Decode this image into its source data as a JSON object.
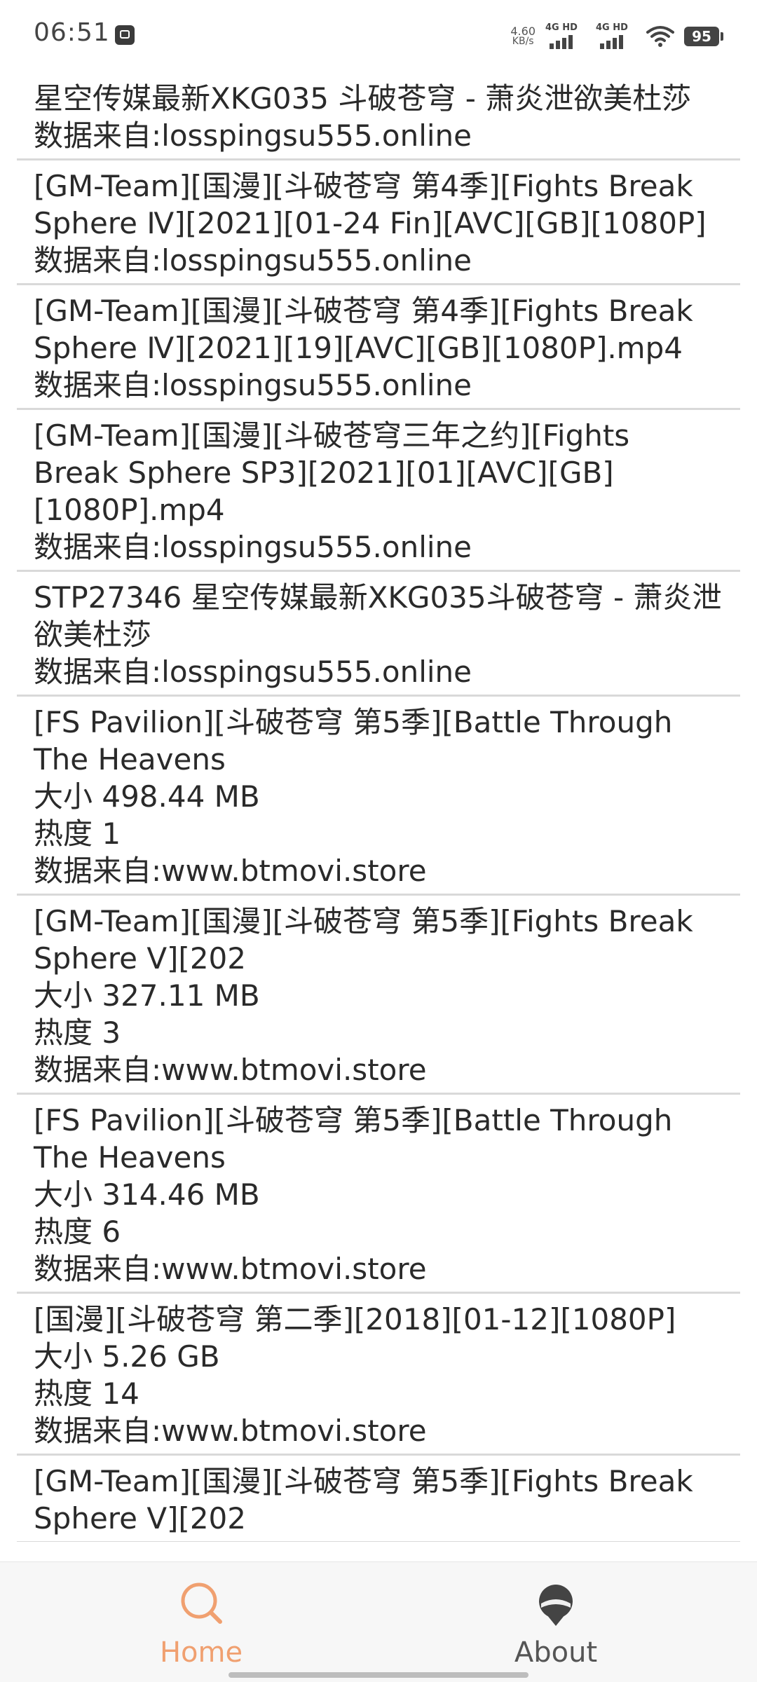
{
  "status_bar": {
    "time": "06:51",
    "net_speed_value": "4.60",
    "net_speed_unit": "KB/s",
    "sim1_label": "4G HD",
    "sim2_label": "4G HD",
    "battery": "95",
    "icons": [
      "app-notification-icon",
      "signal-icon",
      "wifi-icon",
      "battery-icon"
    ]
  },
  "results": [
    {
      "title": "星空传媒最新XKG035 斗破苍穹 - 萧炎泄欲美杜莎",
      "size": "",
      "heat": "",
      "source": " 数据来自:losspingsu555.online"
    },
    {
      "title": "[GM-Team][国漫][斗破苍穹 第4季][Fights Break Sphere Ⅳ][2021][01-24 Fin][AVC][GB][1080P]",
      "size": "",
      "heat": "",
      "source": " 数据来自:losspingsu555.online"
    },
    {
      "title": "[GM-Team][国漫][斗破苍穹 第4季][Fights Break Sphere Ⅳ][2021][19][AVC][GB][1080P].mp4",
      "size": "",
      "heat": "",
      "source": " 数据来自:losspingsu555.online"
    },
    {
      "title": "[GM-Team][国漫][斗破苍穹三年之约][Fights Break Sphere SP3][2021][01][AVC][GB][1080P].mp4",
      "size": "",
      "heat": "",
      "source": " 数据来自:losspingsu555.online"
    },
    {
      "title": "STP27346 星空传媒最新XKG035斗破苍穹 - 萧炎泄欲美杜莎",
      "size": "",
      "heat": "",
      "source": " 数据来自:losspingsu555.online"
    },
    {
      "title": "[FS Pavilion][斗破苍穹 第5季][Battle Through The Heavens",
      "size": "大小 498.44 MB",
      "heat": "热度 1",
      "source": "数据来自:www.btmovi.store"
    },
    {
      "title": "[GM-Team][国漫][斗破苍穹 第5季][Fights Break Sphere Ⅴ][202",
      "size": "大小 327.11 MB",
      "heat": "热度 3",
      "source": "数据来自:www.btmovi.store"
    },
    {
      "title": "[FS Pavilion][斗破苍穹 第5季][Battle Through The Heavens",
      "size": "大小 314.46 MB",
      "heat": "热度 6",
      "source": "数据来自:www.btmovi.store"
    },
    {
      "title": "[国漫][斗破苍穹 第二季][2018][01-12][1080P]",
      "size": "大小 5.26 GB",
      "heat": "热度 14",
      "source": "数据来自:www.btmovi.store"
    },
    {
      "title": "[GM-Team][国漫][斗破苍穹 第5季][Fights Break Sphere Ⅴ][202",
      "size": "",
      "heat": "",
      "source": ""
    }
  ],
  "bottom_nav": {
    "home_label": "Home",
    "about_label": "About",
    "active_color": "#f0a070",
    "inactive_color": "#555555"
  }
}
